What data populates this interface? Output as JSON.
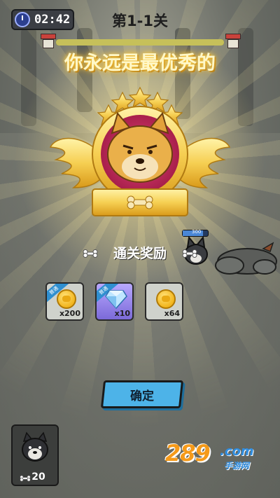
{
  "hud": {
    "timer": "02:42",
    "level_title": "第1-1关",
    "level_progress": 1.0
  },
  "headline": "你永远是最优秀的",
  "enemy": {
    "hp_text": "300"
  },
  "rewards": {
    "title": "通关奖励",
    "items": [
      {
        "tag": "普通",
        "icon": "coin-icon",
        "qty": "x200"
      },
      {
        "tag": "普通",
        "icon": "diamond-icon",
        "qty": "x10"
      },
      {
        "tag": "",
        "icon": "coin-icon",
        "qty": "x64"
      }
    ]
  },
  "confirm_label": "确定",
  "unit_card": {
    "count": "20"
  },
  "watermark": {
    "brand": "289",
    "domain": ".com",
    "sub": "手游网"
  },
  "colors": {
    "accent_gold": "#f2b51d",
    "button_blue": "#4db3e8"
  }
}
